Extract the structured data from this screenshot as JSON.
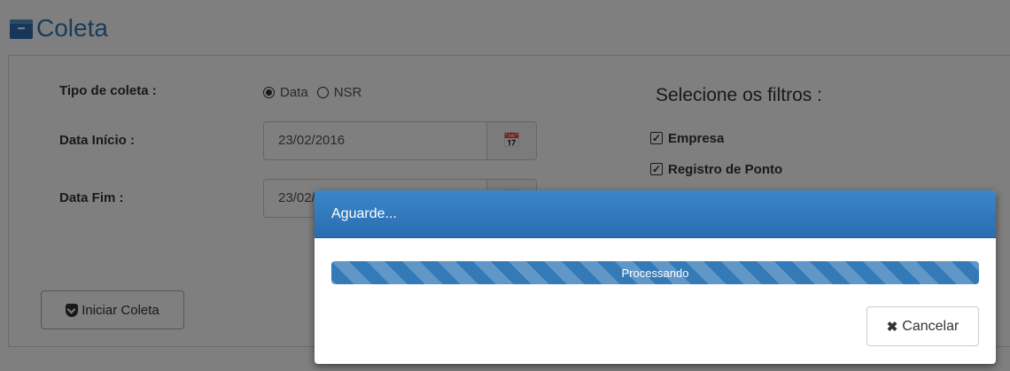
{
  "page": {
    "title": "Coleta",
    "icon": "archive-icon"
  },
  "form": {
    "tipo_label": "Tipo de coleta :",
    "tipo_options": [
      {
        "label": "Data",
        "selected": true
      },
      {
        "label": "NSR",
        "selected": false
      }
    ],
    "data_inicio_label": "Data Início :",
    "data_inicio_value": "23/02/2016",
    "data_fim_label": "Data Fim :",
    "data_fim_value": "23/02/2016",
    "calendar_icon": "calendar-icon",
    "start_button": "Iniciar Coleta"
  },
  "filters": {
    "title": "Selecione os filtros :",
    "items": [
      {
        "label": "Empresa",
        "checked": true
      },
      {
        "label": "Registro de Ponto",
        "checked": true
      }
    ]
  },
  "modal": {
    "title": "Aguarde...",
    "progress_label": "Processando",
    "progress": 1.0,
    "cancel_label": "Cancelar",
    "cancel_icon": "close-icon"
  },
  "colors": {
    "primary": "#337ab7",
    "modal_header": "#2f79bd",
    "overlay": "rgba(0,0,0,0.5)"
  }
}
